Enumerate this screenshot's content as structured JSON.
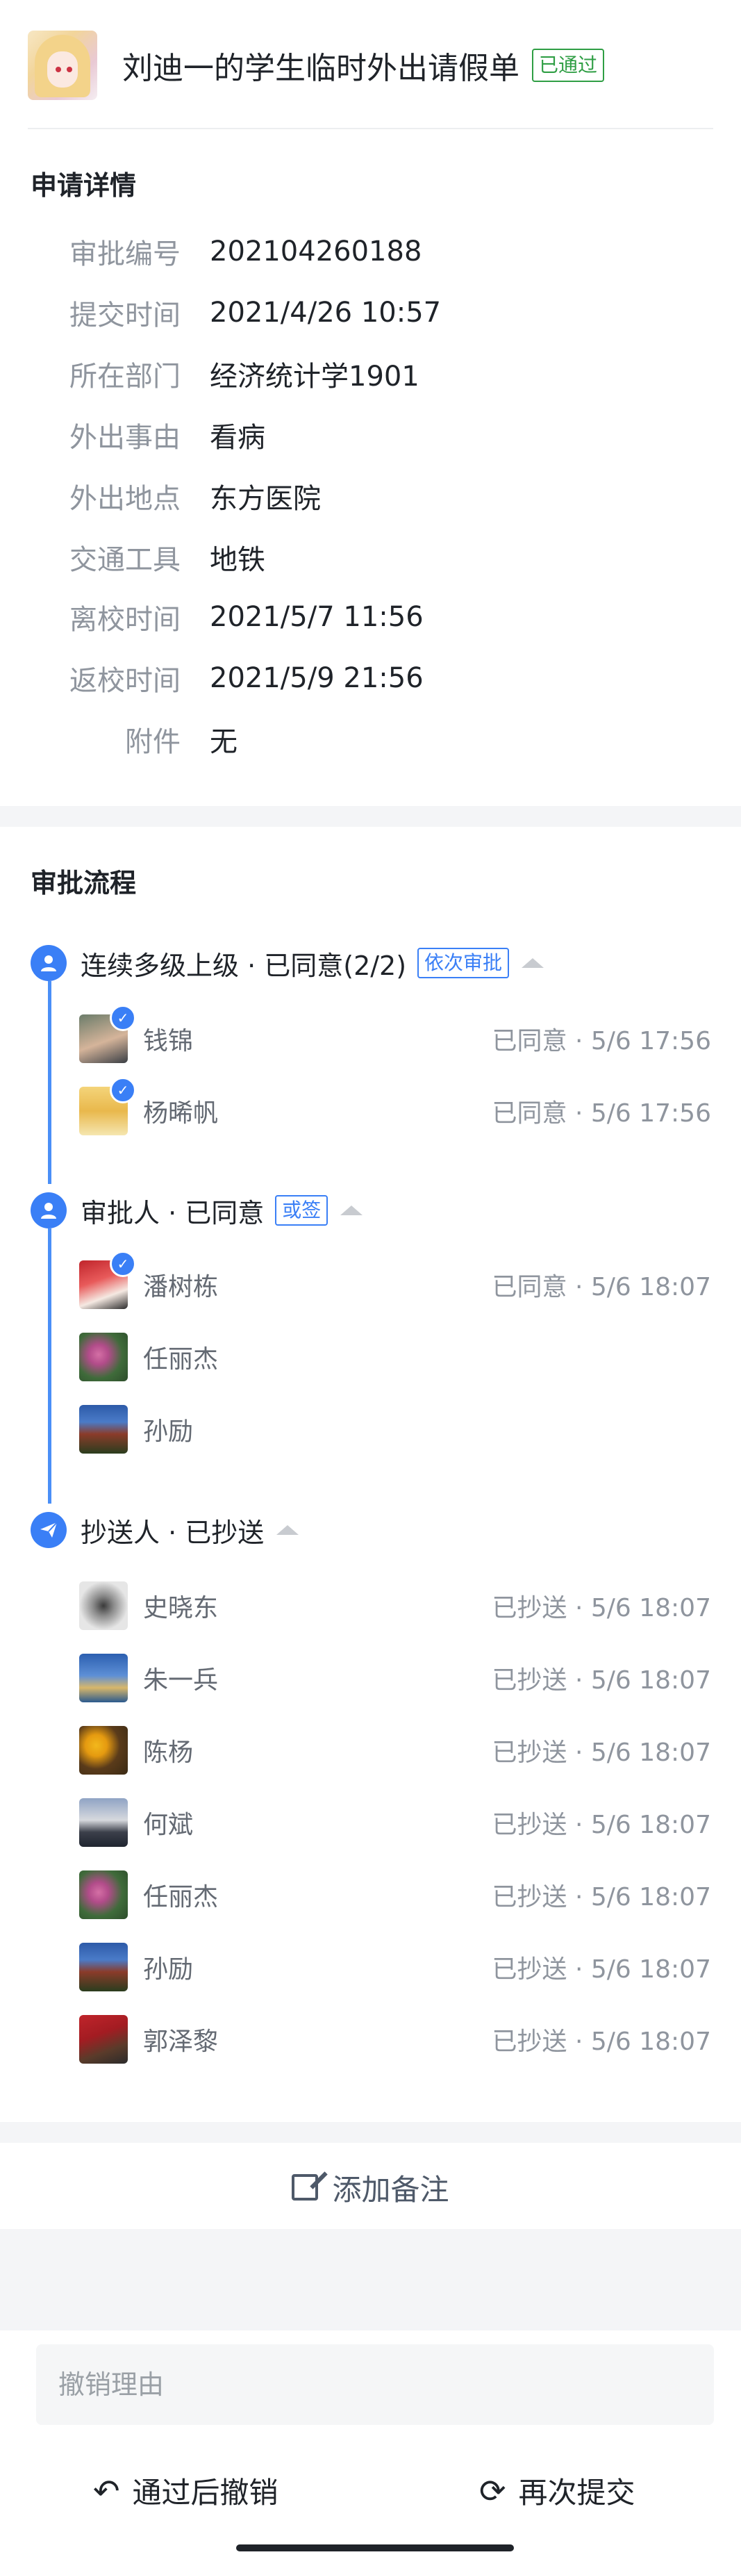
{
  "header": {
    "title": "刘迪一的学生临时外出请假单",
    "status_badge": "已通过"
  },
  "details": {
    "section_title": "申请详情",
    "rows": [
      {
        "label": "审批编号",
        "value": "202104260188"
      },
      {
        "label": "提交时间",
        "value": "2021/4/26 10:57"
      },
      {
        "label": "所在部门",
        "value": "经济统计学1901"
      },
      {
        "label": "外出事由",
        "value": "看病"
      },
      {
        "label": "外出地点",
        "value": "东方医院"
      },
      {
        "label": "交通工具",
        "value": "地铁"
      },
      {
        "label": "离校时间",
        "value": "2021/5/7 11:56"
      },
      {
        "label": "返校时间",
        "value": "2021/5/9 21:56"
      },
      {
        "label": "附件",
        "value": "无"
      }
    ]
  },
  "flow": {
    "section_title": "审批流程",
    "nodes": [
      {
        "title": "连续多级上级 · 已同意(2/2)",
        "tag": "依次审批",
        "icon": "person-icon",
        "people": [
          {
            "name": "钱锦",
            "status": "已同意 · 5/6 17:56",
            "checked": true
          },
          {
            "name": "杨晞帆",
            "status": "已同意 · 5/6 17:56",
            "checked": true
          }
        ]
      },
      {
        "title": "审批人 · 已同意",
        "tag": "或签",
        "icon": "person-icon",
        "people": [
          {
            "name": "潘树栋",
            "status": "已同意 · 5/6 18:07",
            "checked": true
          },
          {
            "name": "任丽杰",
            "status": "",
            "checked": false
          },
          {
            "name": "孙励",
            "status": "",
            "checked": false
          }
        ]
      },
      {
        "title": "抄送人 · 已抄送",
        "tag": "",
        "icon": "send-icon",
        "people": [
          {
            "name": "史晓东",
            "status": "已抄送 · 5/6 18:07"
          },
          {
            "name": "朱一兵",
            "status": "已抄送 · 5/6 18:07"
          },
          {
            "name": "陈杨",
            "status": "已抄送 · 5/6 18:07"
          },
          {
            "name": "何斌",
            "status": "已抄送 · 5/6 18:07"
          },
          {
            "name": "任丽杰",
            "status": "已抄送 · 5/6 18:07"
          },
          {
            "name": "孙励",
            "status": "已抄送 · 5/6 18:07"
          },
          {
            "name": "郭泽黎",
            "status": "已抄送 · 5/6 18:07"
          }
        ]
      }
    ]
  },
  "actions": {
    "add_note": "添加备注",
    "cancel_placeholder": "撤销理由",
    "revoke_button": "通过后撤销",
    "resubmit_button": "再次提交"
  },
  "colors": {
    "accent": "#3a7ff6",
    "passed": "#2f9e44"
  }
}
